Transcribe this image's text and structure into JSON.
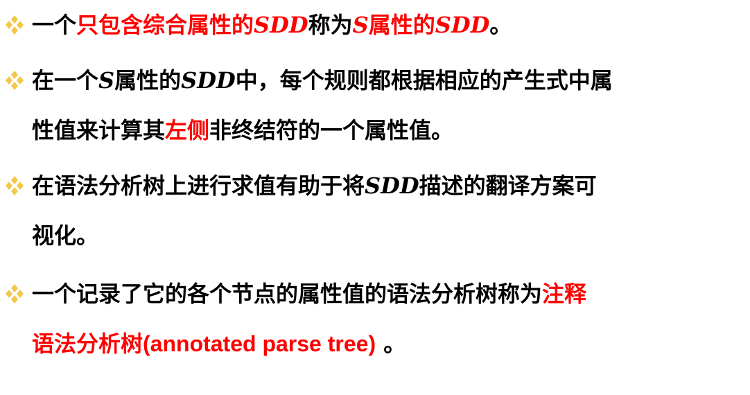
{
  "colors": {
    "text": "#000000",
    "highlight": "#ff0000",
    "bullet_icon": "#f2c84b"
  },
  "bullet_icon": "four-diamond-bullet-icon",
  "bullets": [
    {
      "segments": [
        {
          "text": "一个",
          "style": "normal"
        },
        {
          "text": "只包含综合属性的",
          "style": "red"
        },
        {
          "text": "SDD",
          "style": "red-math"
        },
        {
          "text": "称为",
          "style": "normal"
        },
        {
          "text": "S",
          "style": "red-math"
        },
        {
          "text": "属性的",
          "style": "red"
        },
        {
          "text": "SDD",
          "style": "red-math"
        },
        {
          "text": "。",
          "style": "normal"
        }
      ]
    },
    {
      "segments": [
        {
          "text": "在一个",
          "style": "normal"
        },
        {
          "text": "S",
          "style": "math"
        },
        {
          "text": "属性的",
          "style": "normal"
        },
        {
          "text": "SDD",
          "style": "math"
        },
        {
          "text": "中，每个规则都根据相应的产生式中属",
          "style": "normal"
        },
        {
          "text": "性值来计算其",
          "style": "normal",
          "newline": true
        },
        {
          "text": "左侧",
          "style": "red"
        },
        {
          "text": "非终结符的一个属性值。",
          "style": "normal"
        }
      ]
    },
    {
      "segments": [
        {
          "text": "在语法分析树上进行求值有助于将",
          "style": "normal"
        },
        {
          "text": "SDD",
          "style": "math"
        },
        {
          "text": "描述的翻译方案可",
          "style": "normal"
        },
        {
          "text": "视化。",
          "style": "normal",
          "newline": true
        }
      ]
    },
    {
      "segments": [
        {
          "text": "一个记录了它的各个节点的属性值的语法分析树称为",
          "style": "normal"
        },
        {
          "text": "注释",
          "style": "red"
        },
        {
          "text": "语法分析树",
          "style": "red",
          "newline": true
        },
        {
          "text": "(annotated parse tree)",
          "style": "red-latin"
        },
        {
          "text": " 。",
          "style": "normal"
        }
      ]
    }
  ]
}
